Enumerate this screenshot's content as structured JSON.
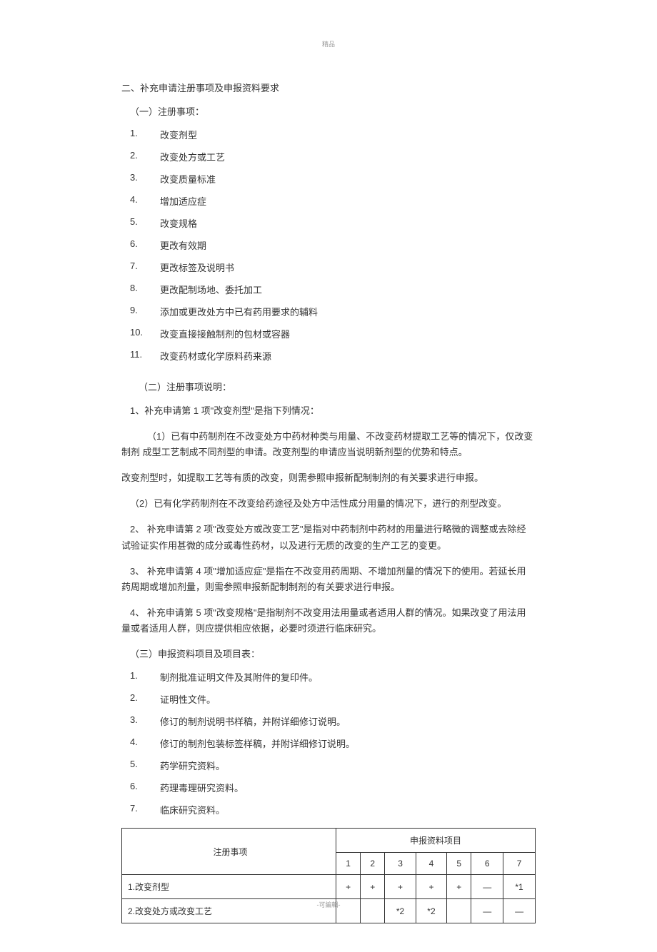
{
  "header_mark": "精品",
  "footer_mark": "-可編輯-",
  "section_title": "二、补充申请注册事项及申报资料要求",
  "reg_title": "（一）注册事项：",
  "reg_items": [
    {
      "num": "1.",
      "text": "改变剂型"
    },
    {
      "num": "2.",
      "text": "改变处方或工艺"
    },
    {
      "num": "3.",
      "text": "改变质量标准"
    },
    {
      "num": "4.",
      "text": "增加适应症"
    },
    {
      "num": "5.",
      "text": "改变规格"
    },
    {
      "num": "6.",
      "text": "更改有效期"
    },
    {
      "num": "7.",
      "text": "更改标签及说明书"
    },
    {
      "num": "8.",
      "text": "更改配制场地、委托加工"
    },
    {
      "num": "9.",
      "text": "添加或更改处方中已有药用要求的辅料"
    },
    {
      "num": "10.",
      "text": "改变直接接触制剂的包材或容器"
    },
    {
      "num": "11.",
      "text": "改变药材或化学原料药来源"
    }
  ],
  "exp_title": "（二）注册事项说明：",
  "exp_1_lead": "1、补充申请第 1 项\"改变剂型\"是指下列情况：",
  "exp_1_p1": "（1）已有中药制剂在不改变处方中药材种类与用量、不改变药材提取工艺等的情况下，仅改变制剂 成型工艺制成不同剂型的申请。改变剂型的申请应当说明新剂型的优势和特点。",
  "exp_1_p2": "改变剂型时，如提取工艺等有质的改变，则需参照申报新配制制剂的有关要求进行申报。",
  "exp_1_p3": "（2）已有化学药制剂在不改变给药途径及处方中活性成分用量的情况下，进行的剂型改变。",
  "exp_2": "2、  补充申请第 2 项\"改变处方或改变工艺\"是指对中药制剂中药材的用量进行略微的调整或去除经 试验证实作用甚微的成分或毒性药材，以及进行无质的改变的生产工艺的变更。",
  "exp_3": "3、  补充申请第 4 项\"增加适应症\"是指在不改变用药周期、不增加剂量的情况下的使用。若延长用 药周期或增加剂量，则需参照申报新配制制剂的有关要求进行申报。",
  "exp_4": "4、  补充申请第 5 项\"改变规格\"是指制剂不改变用法用量或者适用人群的情况。如果改变了用法用 量或者适用人群，则应提供相应依据，必要时须进行临床研究。",
  "mat_title": "（三）申报资料项目及项目表：",
  "mat_items": [
    {
      "num": "1.",
      "text": "制剂批准证明文件及其附件的复印件。"
    },
    {
      "num": "2.",
      "text": "证明性文件。"
    },
    {
      "num": "3.",
      "text": "修订的制剂说明书样稿，并附详细修订说明。"
    },
    {
      "num": "4.",
      "text": "修订的制剂包装标签样稿，并附详细修订说明。"
    },
    {
      "num": "5.",
      "text": "药学研究资料。"
    },
    {
      "num": "6.",
      "text": "药理毒理研究资料。"
    },
    {
      "num": "7.",
      "text": "临床研究资料。"
    }
  ],
  "table": {
    "header_reg": "注册事项",
    "header_mat": "申报资料项目",
    "cols": [
      "1",
      "2",
      "3",
      "4",
      "5",
      "6",
      "7"
    ],
    "rows": [
      {
        "label": "1.改变剂型",
        "cells": [
          "+",
          "+",
          "+",
          "+",
          "+",
          "—",
          "*1"
        ]
      },
      {
        "label": "2.改变处方或改变工艺",
        "cells": [
          "",
          "",
          "*2",
          "*2",
          "",
          "—",
          "—"
        ]
      }
    ]
  }
}
